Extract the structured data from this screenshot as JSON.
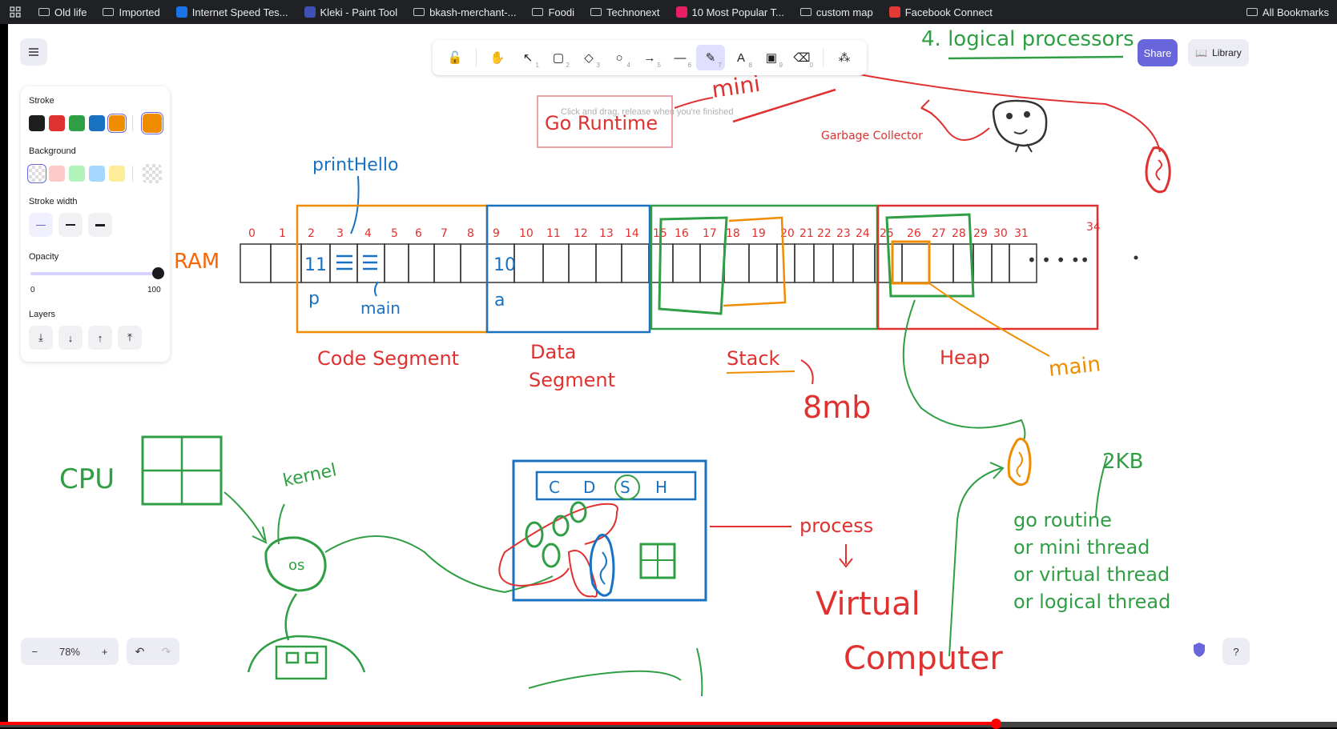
{
  "bookmarks": [
    {
      "label": "Old life",
      "icon": "folder-icon"
    },
    {
      "label": "Imported",
      "icon": "folder-icon"
    },
    {
      "label": "Internet Speed Tes...",
      "icon": "speedtest-icon"
    },
    {
      "label": "Kleki - Paint Tool",
      "icon": "kleki-icon"
    },
    {
      "label": "bkash-merchant-...",
      "icon": "folder-icon"
    },
    {
      "label": "Foodi",
      "icon": "folder-icon"
    },
    {
      "label": "Technonext",
      "icon": "folder-icon"
    },
    {
      "label": "10 Most Popular T...",
      "icon": "tf-icon"
    },
    {
      "label": "custom map",
      "icon": "folder-icon"
    },
    {
      "label": "Facebook Connect",
      "icon": "fb-connect-icon"
    }
  ],
  "all_bookmarks": "All Bookmarks",
  "toolbar": {
    "tools": [
      {
        "name": "lock-tool",
        "glyph": "🔓",
        "key": ""
      },
      {
        "name": "hand-tool",
        "glyph": "✋",
        "key": ""
      },
      {
        "name": "selection-tool",
        "glyph": "↖",
        "key": "1"
      },
      {
        "name": "rectangle-tool",
        "glyph": "▢",
        "key": "2"
      },
      {
        "name": "diamond-tool",
        "glyph": "◇",
        "key": "3"
      },
      {
        "name": "ellipse-tool",
        "glyph": "○",
        "key": "4"
      },
      {
        "name": "arrow-tool",
        "glyph": "→",
        "key": "5"
      },
      {
        "name": "line-tool",
        "glyph": "—",
        "key": "6"
      },
      {
        "name": "draw-tool",
        "glyph": "✎",
        "key": "7",
        "active": true
      },
      {
        "name": "text-tool",
        "glyph": "A",
        "key": "8"
      },
      {
        "name": "image-tool",
        "glyph": "▣",
        "key": "9"
      },
      {
        "name": "eraser-tool",
        "glyph": "⌫",
        "key": "0"
      },
      {
        "name": "more-tools",
        "glyph": "⁂",
        "key": ""
      }
    ],
    "hint": "Click and drag, release when you're finished"
  },
  "share_label": "Share",
  "library_label": "Library",
  "props": {
    "stroke_label": "Stroke",
    "stroke_colors": [
      "#1e1e1e",
      "#e03131",
      "#2f9e44",
      "#1971c2",
      "#f08c00"
    ],
    "stroke_current": "#f08c00",
    "background_label": "Background",
    "background_colors": [
      "transparent",
      "#ffc9c9",
      "#b2f2bb",
      "#a5d8ff",
      "#ffec99"
    ],
    "stroke_width_label": "Stroke width",
    "opacity_label": "Opacity",
    "opacity_min": "0",
    "opacity_max": "100",
    "opacity_value": 100,
    "layers_label": "Layers"
  },
  "zoom": {
    "minus": "−",
    "value": "78%",
    "plus": "+"
  },
  "undo_glyph": "↶",
  "redo_glyph": "↷",
  "help_glyph": "?",
  "video_progress": 0.745,
  "drawing": {
    "title": "4. logical processors",
    "go_runtime": "Go Runtime",
    "mini_top": "mini",
    "garbage_collector": "Garbage Collector",
    "print_hello": "printHello",
    "ram": "RAM",
    "cells": [
      "0",
      "1",
      "2",
      "3",
      "4",
      "5",
      "6",
      "7",
      "8",
      "9",
      "10",
      "11",
      "12",
      "13",
      "14",
      "15",
      "16",
      "17",
      "18",
      "19",
      "20",
      "21",
      "22",
      "23",
      "24",
      "25",
      "26",
      "27",
      "28",
      "29",
      "30",
      "31",
      "34"
    ],
    "val_11": "11",
    "val_10": "10",
    "lbl_p": "p",
    "lbl_a": "a",
    "lbl_main": "main",
    "code_segment": "Code Segment",
    "data_segment_1": "Data",
    "data_segment_2": "Segment",
    "stack": "Stack",
    "stack_size": "8mb",
    "heap": "Heap",
    "heap_main": "main",
    "cpu": "CPU",
    "kernel": "kernel",
    "os": "os",
    "proc_c": "C",
    "proc_d": "D",
    "proc_s": "S",
    "proc_h": "H",
    "process": "process",
    "virtual": "Virtual",
    "computer": "Computer",
    "size_2kb": "2KB",
    "goroutine_lines": [
      "go routine",
      "or mini thread",
      "or virtual thread",
      "or logical thread"
    ]
  }
}
